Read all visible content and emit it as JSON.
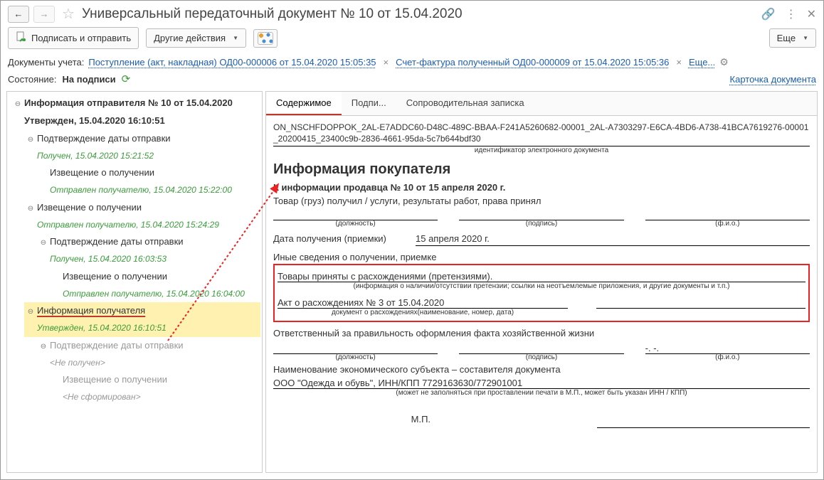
{
  "header": {
    "title": "Универсальный передаточный документ № 10 от 15.04.2020"
  },
  "toolbar": {
    "sign_send": "Подписать и отправить",
    "other": "Другие действия",
    "more": "Еще"
  },
  "docs_row": {
    "label": "Документы учета:",
    "link1": "Поступление (акт, накладная) ОД00-000006 от 15.04.2020 15:05:35",
    "link2": "Счет-фактура полученный ОД00-000009 от 15.04.2020 15:05:36",
    "more": "Еще..."
  },
  "status": {
    "label": "Состояние:",
    "value": "На подписи",
    "card_link": "Карточка документа"
  },
  "tree": {
    "root": "Информация отправителя № 10 от 15.04.2020",
    "root_status": "Утвержден, 15.04.2020 16:10:51",
    "n1": "Подтверждение даты отправки",
    "n1s": "Получен, 15.04.2020 15:21:52",
    "n2": "Извещение о получении",
    "n2s": "Отправлен получателю, 15.04.2020 15:22:00",
    "n3": "Извещение о получении",
    "n3s": "Отправлен получателю, 15.04.2020 15:24:29",
    "n4": "Подтверждение даты отправки",
    "n4s": "Получен, 15.04.2020 16:03:53",
    "n5": "Извещение о получении",
    "n5s": "Отправлен получателю, 15.04.2020 16:04:00",
    "n6": "Информация получателя",
    "n6s": "Утвержден, 15.04.2020 16:10:51",
    "n7": "Подтверждение даты отправки",
    "n7s": "<Не получен>",
    "n8": "Извещение о получении",
    "n8s": "<Не сформирован>"
  },
  "tabs": {
    "t1": "Содержимое",
    "t2": "Подпи...",
    "t3": "Сопроводительная записка"
  },
  "doc": {
    "id": "ON_NSCHFDOPPOK_2AL-E7ADDC60-D48C-489C-BBAA-F241A5260682-00001_2AL-A7303297-E6CA-4BD6-A738-41BCA7619276-00001_20200415_23400c9b-2836-4661-95da-5c7b644bdf30",
    "id_cap": "идентификатор электронного документа",
    "title": "Информация покупателя",
    "ref": "К информации продавца № 10 от 15 апреля 2020 г.",
    "recv": "Товар (груз) получил / услуги, результаты работ, права принял",
    "sig_pos": "(должность)",
    "sig_sign": "(подпись)",
    "sig_name": "(ф.и.о.)",
    "date_lab": "Дата получения (приемки)",
    "date_val": "15 апреля 2020 г.",
    "other_lab": "Иные сведения о получении, приемке",
    "disc1": "Товары приняты с расхождениями (претензиями).",
    "disc1_cap": "(информация о наличии/отсутствии претензии; ссылки на неотъемлемые приложения, и другие  документы и т.п.)",
    "disc2": "Акт о расхождениях № 3 от 15.04.2020",
    "disc2_cap": "документ о расхождениях(наименование, номер, дата)",
    "resp": "Ответственный за правильность оформления факта хозяйственной жизни",
    "dashes": "-. -.",
    "org_lab": "Наименование экономического субъекта – составителя документа",
    "org_val": "ООО \"Одежда и обувь\", ИНН/КПП 7729163630/772901001",
    "org_cap": "(может не заполняться при проставлении печати в М.П., может быть указан ИНН / КПП)",
    "mp": "М.П."
  }
}
